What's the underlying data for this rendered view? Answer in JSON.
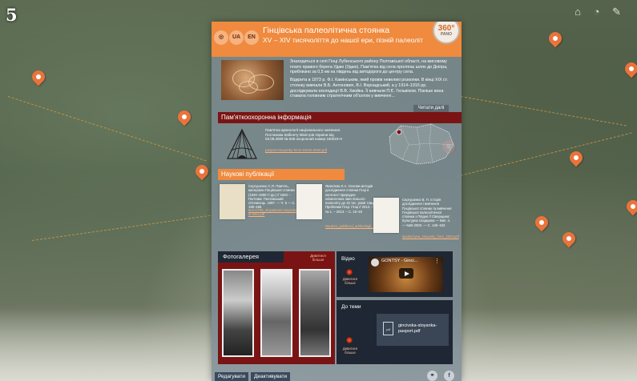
{
  "figure_number": "5",
  "header": {
    "lang_ua": "UA",
    "lang_en": "EN",
    "title": "Гінцівська палеолітична стоянка",
    "subtitle": "XV – XIV тисячоліття до нашої ери, пізній палеоліт",
    "pano_label": "360°",
    "pano_caption": "PANO"
  },
  "intro": {
    "text_1": "Знаходиться в селі Гінці Лубенського району Полтавської області, на мисовому плато правого берега Удаю (Удаю). Пам'ятка від села пролягає шлях до Дніпра, приблизно за 0,5 км на південь від автодороги до центру села.",
    "text_2": "Відкрита в 1873 р. Ф.І. Камінським, який провів невеликі розкопки. В кінці XIX ст. стоянку вивчали В.Б. Антонович, В.І. Вернадський, а у 1914–1916 рр. досліджували експедиції В.В. Хвойка. Її вивчали П.Є. Гельвіхом. Пізніше вона ставала головним стратегічним об'єктом у вивченні...",
    "read_more": "Читати далі"
  },
  "protection": {
    "heading": "Пам'яткоохоронна інформація",
    "text": "Пам'ятка археології національного значення. Постанова Кабінету Міністрів України від 03.09.2009 № 928 охоронний номер 160023-Н",
    "link": "pasport-stoyanky-hinci-Gintsi-2020.pdf"
  },
  "publications": {
    "heading": "Наукові публікації",
    "items": [
      {
        "text": "Сергушенко С.Я. Пам'ять, матеріали Гінцівської стоянки (1940–1950-ті рр.) // 1940 – Полтава: Полтавський літописець. 1997. — Ч. 5 — С. 195–195",
        "link": "text-1/755_stoyankami-stoyanka-in-ihnci.pdf"
      },
      {
        "text": "Яковлєва Л.А. Основи методів дослідження стоянки Гінці в контексті природно-кліматичних змін пізнього палеоліту до 15 тис. років тому. Проблеми Гінці. Гінці // 2013. – № 1. – 2013. – С. 15–20",
        "link": "Naukovi_publikacii_arkheologii_stoyanky.pdf"
      },
      {
        "text": "Сергушенко В. П. Історія дослідження і вивчення Гінцівської стоянки та вивчення Гінцівської палеолітичної стоянки з Півдня // Сіверщина: Культурна спадщина — Вип. 4. — Київ 2003. — С. 145–153",
        "link": "spadschyna_stoyanky_hinci_2003.pdf"
      }
    ]
  },
  "gallery": {
    "title": "Фотогалерея",
    "more": "Дивитися більше"
  },
  "video": {
    "label": "Відео",
    "more": "Дивитися більше",
    "thumb_title": "GONTSY - Ginci..."
  },
  "topic": {
    "label": "До теми",
    "more": "Дивитися більше",
    "file_name": "gincivska-stoyanka-pasport.pdf",
    "file_type": "pdf"
  },
  "bottom": {
    "edit": "Редагувати",
    "deactivate": "Деактивувати"
  },
  "colors": {
    "accent_orange": "#ef8a3e",
    "dark_red": "#7a1414",
    "navy": "#1e2733"
  }
}
